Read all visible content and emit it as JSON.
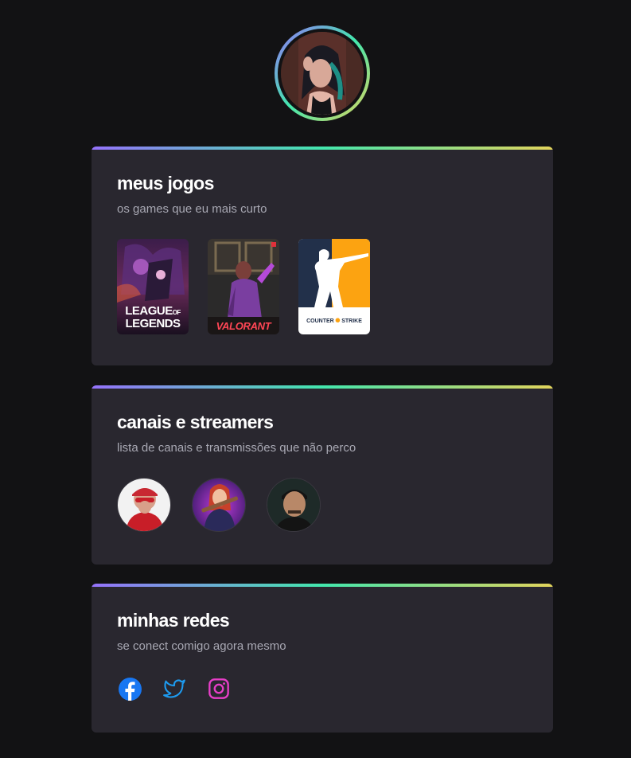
{
  "profile": {
    "avatar_icon": "profile-photo"
  },
  "games_card": {
    "title": "meus jogos",
    "subtitle": "os games que eu mais curto",
    "games": [
      {
        "name": "league-of-legends",
        "logo_line1": "LEAGUE",
        "logo_of": "OF",
        "logo_line2": "LEGENDS"
      },
      {
        "name": "valorant",
        "logo": "VALORANT",
        "color": "#ff4655"
      },
      {
        "name": "counter-strike",
        "logo_left": "COUNTER",
        "logo_right": "STRIKE",
        "color": "#fca311"
      }
    ]
  },
  "streamers_card": {
    "title": "canais e streamers",
    "subtitle": "lista de canais e transmissões que não perco",
    "streamers": [
      {
        "name": "streamer-1"
      },
      {
        "name": "streamer-2"
      },
      {
        "name": "streamer-3"
      }
    ]
  },
  "social_card": {
    "title": "minhas redes",
    "subtitle": "se conect comigo agora mesmo",
    "links": [
      {
        "name": "facebook-icon",
        "color": "#1877f2"
      },
      {
        "name": "twitter-icon",
        "color": "#1d9bf0"
      },
      {
        "name": "instagram-icon",
        "color": "#e83ec8"
      }
    ]
  }
}
